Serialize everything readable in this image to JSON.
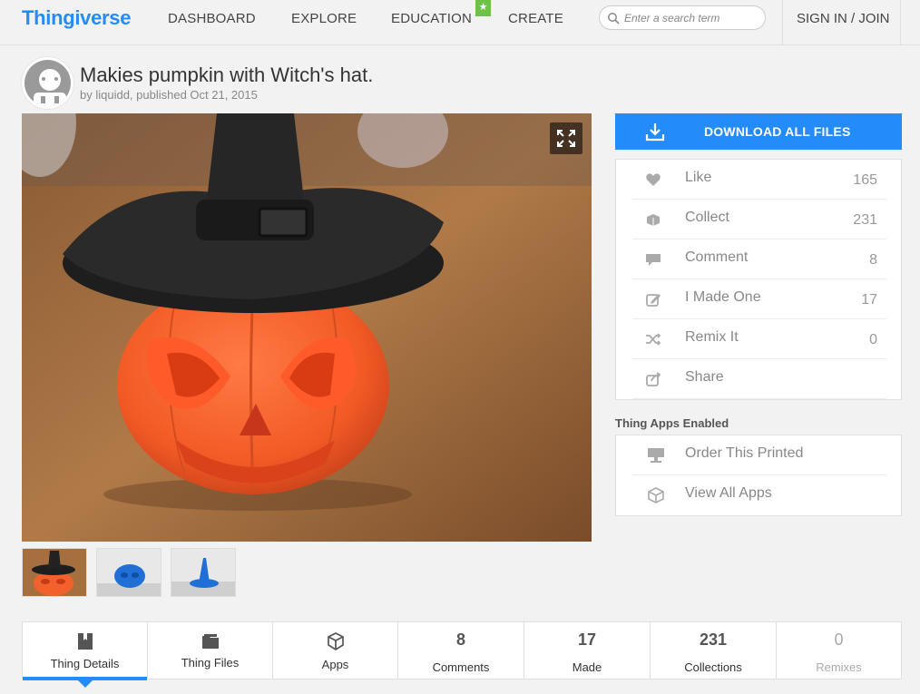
{
  "header": {
    "logo": "Thingiverse",
    "nav": [
      {
        "label": "DASHBOARD"
      },
      {
        "label": "EXPLORE"
      },
      {
        "label": "EDUCATION"
      },
      {
        "label": "CREATE"
      }
    ],
    "search_placeholder": "Enter a search term",
    "signin_label": "SIGN IN / JOIN"
  },
  "thing": {
    "title": "Makies pumpkin with Witch's hat.",
    "byline": "by liquidd, published Oct 21, 2015"
  },
  "download": {
    "label": "DOWNLOAD ALL FILES"
  },
  "actions": [
    {
      "label": "Like",
      "count": "165",
      "icon": "heart-icon"
    },
    {
      "label": "Collect",
      "count": "231",
      "icon": "collect-icon"
    },
    {
      "label": "Comment",
      "count": "8",
      "icon": "comment-icon"
    },
    {
      "label": "I Made One",
      "count": "17",
      "icon": "made-icon"
    },
    {
      "label": "Remix It",
      "count": "0",
      "icon": "shuffle-icon"
    },
    {
      "label": "Share",
      "count": "",
      "icon": "share-icon"
    }
  ],
  "apps": {
    "heading": "Thing Apps Enabled",
    "items": [
      {
        "label": "Order This Printed",
        "icon": "printer-icon"
      },
      {
        "label": "View All Apps",
        "icon": "cube-icon"
      }
    ]
  },
  "tabs": [
    {
      "label": "Thing Details",
      "number": "",
      "icon": "book-icon"
    },
    {
      "label": "Thing Files",
      "number": "",
      "icon": "folder-icon"
    },
    {
      "label": "Apps",
      "number": "",
      "icon": "cube-icon"
    },
    {
      "label": "Comments",
      "number": "8"
    },
    {
      "label": "Made",
      "number": "17"
    },
    {
      "label": "Collections",
      "number": "231"
    },
    {
      "label": "Remixes",
      "number": "0"
    }
  ],
  "colors": {
    "accent": "#248bfb",
    "education_badge": "#6dc24b"
  }
}
